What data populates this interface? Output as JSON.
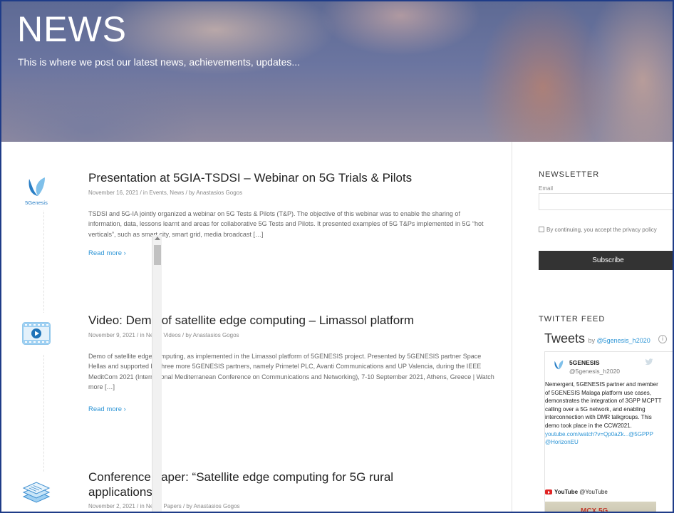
{
  "hero": {
    "title": "NEWS",
    "subtitle": "This is where we post our latest news, achievements, updates..."
  },
  "posts": [
    {
      "title": "Presentation at 5GIA-TSDSI – Webinar on 5G Trials & Pilots",
      "meta": "November 16, 2021 / in Events, News / by Anastasios Gogos",
      "excerpt": "TSDSI and 5G-IA jointly organized a webinar on 5G Tests & Pilots (T&P). The objective of this webinar was to enable the sharing of information, data, lessons learnt and areas for collaborative 5G Tests and Pilots. It presented examples of 5G T&Ps implemented in 5G “hot verticals”, such as smart city, smart grid, media broadcast […]",
      "read_more": "Read more ›",
      "icon": "5genesis-logo-icon",
      "icon_label": "5Genesis"
    },
    {
      "title": "Video: Demo of satellite edge computing – Limassol platform",
      "meta": "November 9, 2021 / in News, Videos / by Anastasios Gogos",
      "excerpt": "Demo of satellite edge computing, as implemented in the Limassol platform of 5GENESIS project. Presented by 5GENESIS partner Space Hellas and supported by three more 5GENESIS partners, namely Primetel PLC, Avanti Communications and UP Valencia, during the IEEE MeditCom 2021 (International Mediterranean Conference on Communications and Networking), 7-10 September 2021, Athens, Greece | Watch more […]",
      "read_more": "Read more ›",
      "icon": "video-icon"
    },
    {
      "title": "Conference paper: “Satellite edge computing for 5G rural applications”",
      "meta": "November 2, 2021 / in News, Papers / by Anastasios Gogos",
      "icon": "papers-stack-icon"
    }
  ],
  "sidebar": {
    "newsletter_heading": "NEWSLETTER",
    "email_label": "Email",
    "email_value": "",
    "consent_text": "By continuing, you accept the privacy policy",
    "subscribe_label": "Subscribe",
    "twitter_heading": "TWITTER FEED",
    "tweets_title": "Tweets",
    "tweets_by": "by",
    "tweets_handle": "@5genesis_h2020",
    "info_glyph": "i",
    "tweet": {
      "name": "5GENESIS",
      "handle": "@5genesis_h2020",
      "text": "Nemergent, 5GENESIS partner and member of 5GENESIS Malaga platform use cases, demonstrates the integration of 3GPP MCPTT calling over a 5G network, and enabling interconnection with DMR talkgroups. This demo took place in the CCW2021.",
      "link1": "youtube.com/watch?v=Qp0aZk...",
      "mentions": "@5GPPP @HorizonEU",
      "yt_name": "YouTube",
      "yt_handle": "@YouTube",
      "thumb_text": "MCX 5G"
    }
  },
  "colors": {
    "link": "#2f96d6",
    "subscribe_bg": "#333333",
    "frame": "#1f3c88",
    "logo_blue": "#2a7fc6",
    "logo_light": "#7fc0ea"
  }
}
